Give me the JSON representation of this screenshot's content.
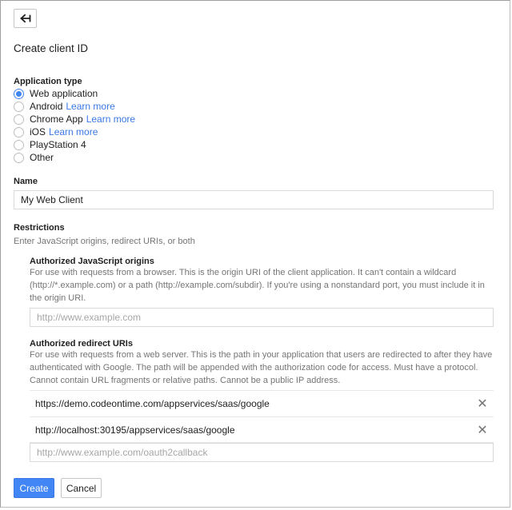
{
  "header": {
    "back_icon": "back-arrow-icon",
    "title": "Create client ID"
  },
  "application_type": {
    "label": "Application type",
    "selected": "Web application",
    "options": [
      {
        "label": "Web application",
        "link": "",
        "checked": true
      },
      {
        "label": "Android",
        "link": "Learn more",
        "checked": false
      },
      {
        "label": "Chrome App",
        "link": "Learn more",
        "checked": false
      },
      {
        "label": "iOS",
        "link": "Learn more",
        "checked": false
      },
      {
        "label": "PlayStation 4",
        "link": "",
        "checked": false
      },
      {
        "label": "Other",
        "link": "",
        "checked": false
      }
    ]
  },
  "name_field": {
    "label": "Name",
    "value": "My Web Client"
  },
  "restrictions": {
    "label": "Restrictions",
    "hint": "Enter JavaScript origins, redirect URIs, or both",
    "js_origins": {
      "label": "Authorized JavaScript origins",
      "desc_line1": "For use with requests from a browser. This is the origin URI of the client application. It can't contain a wildcard",
      "desc_line2": "(http://*.example.com) or a path (http://example.com/subdir). If you're using a nonstandard port, you must include it in",
      "desc_line3": "the origin URI.",
      "placeholder": "http://www.example.com"
    },
    "redirect_uris": {
      "label": "Authorized redirect URIs",
      "desc_line1": "For use with requests from a web server. This is the path in your application that users are redirected to after they have",
      "desc_line2": "authenticated with Google. The path will be appended with the authorization code for access. Must have a protocol.",
      "desc_line3": "Cannot contain URL fragments or relative paths. Cannot be a public IP address.",
      "items": [
        "https://demo.codeontime.com/appservices/saas/google",
        "http://localhost:30195/appservices/saas/google"
      ],
      "remove_icon": "close-icon",
      "placeholder": "http://www.example.com/oauth2callback"
    }
  },
  "actions": {
    "create_label": "Create",
    "cancel_label": "Cancel",
    "primary_color": "#4285f4"
  }
}
